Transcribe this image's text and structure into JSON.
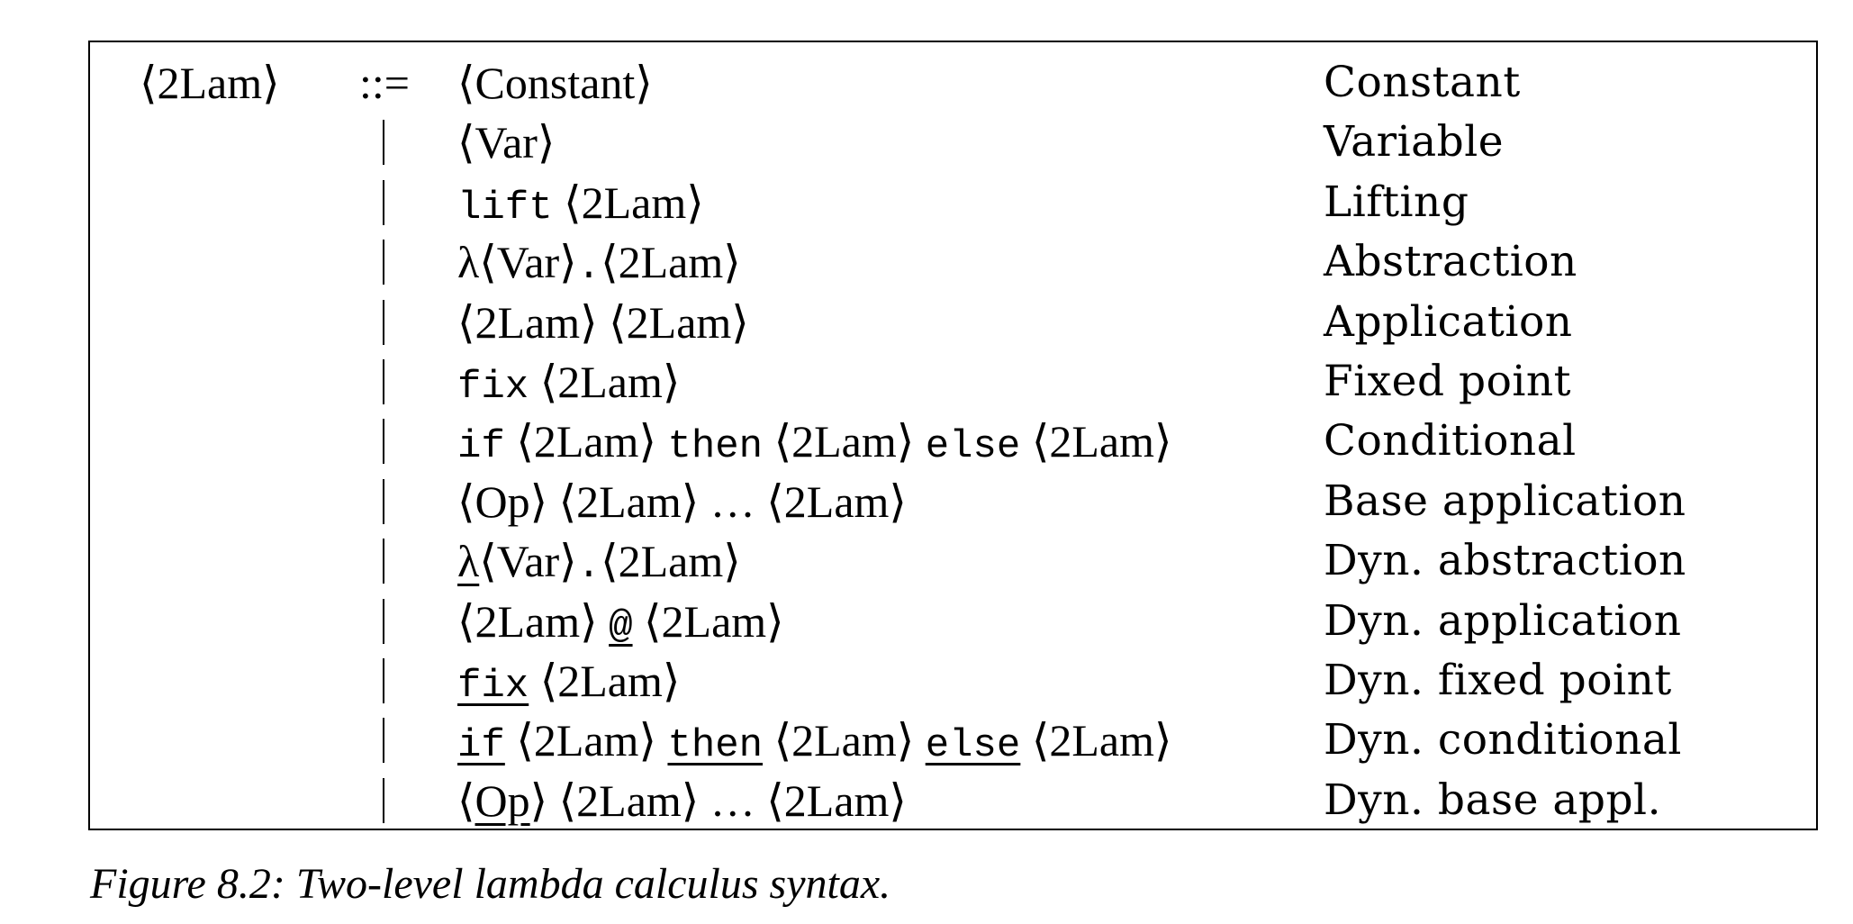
{
  "grammar": {
    "lhs": "⟨2Lam⟩",
    "define_symbol": "::=",
    "alternative_symbol": "|",
    "productions": [
      {
        "tokens": [
          {
            "text": "⟨Constant⟩",
            "kind": "nonterminal",
            "underline": false
          }
        ],
        "description": "Constant"
      },
      {
        "tokens": [
          {
            "text": "⟨Var⟩",
            "kind": "nonterminal",
            "underline": false
          }
        ],
        "description": "Variable"
      },
      {
        "tokens": [
          {
            "text": "lift",
            "kind": "keyword",
            "underline": false
          },
          {
            "text": " ",
            "kind": "space",
            "underline": false
          },
          {
            "text": "⟨2Lam⟩",
            "kind": "nonterminal",
            "underline": false
          }
        ],
        "description": "Lifting"
      },
      {
        "tokens": [
          {
            "text": "λ",
            "kind": "symbol",
            "underline": false
          },
          {
            "text": "⟨Var⟩",
            "kind": "nonterminal",
            "underline": false
          },
          {
            "text": ".",
            "kind": "keyword",
            "underline": false
          },
          {
            "text": "⟨2Lam⟩",
            "kind": "nonterminal",
            "underline": false
          }
        ],
        "description": "Abstraction"
      },
      {
        "tokens": [
          {
            "text": "⟨2Lam⟩",
            "kind": "nonterminal",
            "underline": false
          },
          {
            "text": " ",
            "kind": "space",
            "underline": false
          },
          {
            "text": "⟨2Lam⟩",
            "kind": "nonterminal",
            "underline": false
          }
        ],
        "description": "Application"
      },
      {
        "tokens": [
          {
            "text": "fix",
            "kind": "keyword",
            "underline": false
          },
          {
            "text": " ",
            "kind": "space",
            "underline": false
          },
          {
            "text": "⟨2Lam⟩",
            "kind": "nonterminal",
            "underline": false
          }
        ],
        "description": "Fixed point"
      },
      {
        "tokens": [
          {
            "text": "if",
            "kind": "keyword",
            "underline": false
          },
          {
            "text": " ",
            "kind": "space",
            "underline": false
          },
          {
            "text": "⟨2Lam⟩",
            "kind": "nonterminal",
            "underline": false
          },
          {
            "text": " ",
            "kind": "space",
            "underline": false
          },
          {
            "text": "then",
            "kind": "keyword",
            "underline": false
          },
          {
            "text": " ",
            "kind": "space",
            "underline": false
          },
          {
            "text": "⟨2Lam⟩",
            "kind": "nonterminal",
            "underline": false
          },
          {
            "text": " ",
            "kind": "space",
            "underline": false
          },
          {
            "text": "else",
            "kind": "keyword",
            "underline": false
          },
          {
            "text": " ",
            "kind": "space",
            "underline": false
          },
          {
            "text": "⟨2Lam⟩",
            "kind": "nonterminal",
            "underline": false
          }
        ],
        "description": "Conditional"
      },
      {
        "tokens": [
          {
            "text": "⟨Op⟩",
            "kind": "nonterminal",
            "underline": false
          },
          {
            "text": " ",
            "kind": "space",
            "underline": false
          },
          {
            "text": "⟨2Lam⟩",
            "kind": "nonterminal",
            "underline": false
          },
          {
            "text": " … ",
            "kind": "symbol",
            "underline": false
          },
          {
            "text": "⟨2Lam⟩",
            "kind": "nonterminal",
            "underline": false
          }
        ],
        "description": "Base application"
      },
      {
        "tokens": [
          {
            "text": "λ",
            "kind": "symbol",
            "underline": true
          },
          {
            "text": "⟨Var⟩",
            "kind": "nonterminal",
            "underline": false
          },
          {
            "text": ".",
            "kind": "keyword",
            "underline": false
          },
          {
            "text": "⟨2Lam⟩",
            "kind": "nonterminal",
            "underline": false
          }
        ],
        "description": "Dyn. abstraction"
      },
      {
        "tokens": [
          {
            "text": "⟨2Lam⟩",
            "kind": "nonterminal",
            "underline": false
          },
          {
            "text": " ",
            "kind": "space",
            "underline": false
          },
          {
            "text": "@",
            "kind": "keyword",
            "underline": true
          },
          {
            "text": " ",
            "kind": "space",
            "underline": false
          },
          {
            "text": "⟨2Lam⟩",
            "kind": "nonterminal",
            "underline": false
          }
        ],
        "description": "Dyn. application"
      },
      {
        "tokens": [
          {
            "text": "fix",
            "kind": "keyword",
            "underline": true
          },
          {
            "text": " ",
            "kind": "space",
            "underline": false
          },
          {
            "text": "⟨2Lam⟩",
            "kind": "nonterminal",
            "underline": false
          }
        ],
        "description": "Dyn. fixed point"
      },
      {
        "tokens": [
          {
            "text": "if",
            "kind": "keyword",
            "underline": true
          },
          {
            "text": " ",
            "kind": "space",
            "underline": false
          },
          {
            "text": "⟨2Lam⟩",
            "kind": "nonterminal",
            "underline": false
          },
          {
            "text": " ",
            "kind": "space",
            "underline": false
          },
          {
            "text": "then",
            "kind": "keyword",
            "underline": true
          },
          {
            "text": " ",
            "kind": "space",
            "underline": false
          },
          {
            "text": "⟨2Lam⟩",
            "kind": "nonterminal",
            "underline": false
          },
          {
            "text": " ",
            "kind": "space",
            "underline": false
          },
          {
            "text": "else",
            "kind": "keyword",
            "underline": true
          },
          {
            "text": " ",
            "kind": "space",
            "underline": false
          },
          {
            "text": "⟨2Lam⟩",
            "kind": "nonterminal",
            "underline": false
          }
        ],
        "description": "Dyn. conditional"
      },
      {
        "tokens": [
          {
            "text": "⟨",
            "kind": "symbol",
            "underline": false
          },
          {
            "text": "Op",
            "kind": "nonterminal",
            "underline": true
          },
          {
            "text": "⟩",
            "kind": "symbol",
            "underline": false
          },
          {
            "text": " ",
            "kind": "space",
            "underline": false
          },
          {
            "text": "⟨2Lam⟩",
            "kind": "nonterminal",
            "underline": false
          },
          {
            "text": " … ",
            "kind": "symbol",
            "underline": false
          },
          {
            "text": "⟨2Lam⟩",
            "kind": "nonterminal",
            "underline": false
          }
        ],
        "description": "Dyn. base appl."
      }
    ]
  },
  "caption": "Figure 8.2: Two-level lambda calculus syntax."
}
